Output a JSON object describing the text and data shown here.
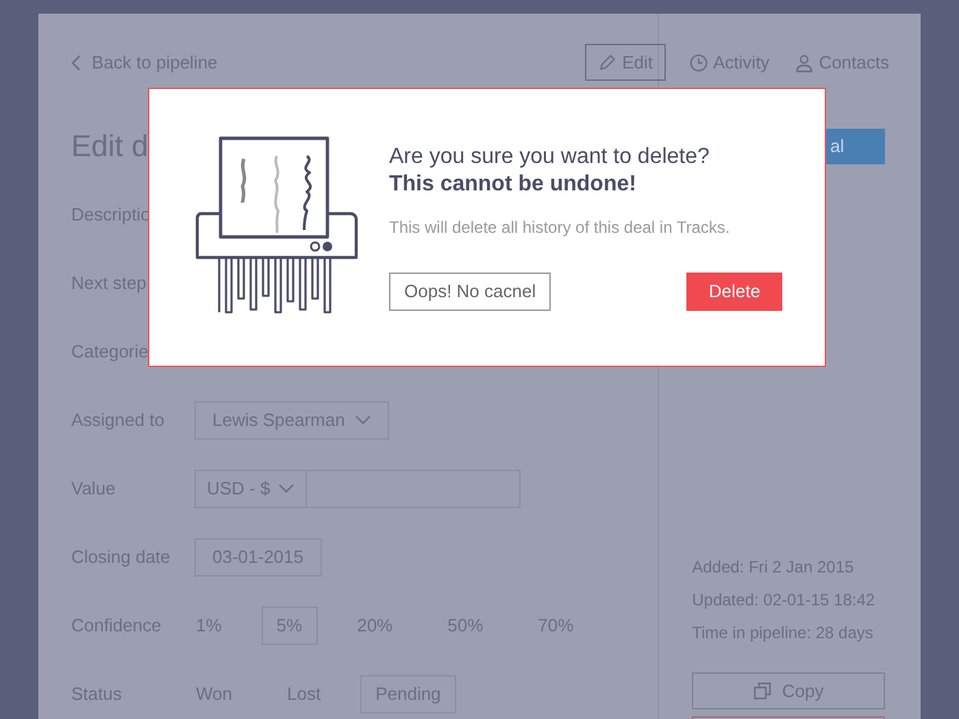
{
  "header": {
    "back_link": "Back to pipeline",
    "nav": [
      {
        "label": "Edit",
        "selected": true
      },
      {
        "label": "Activity",
        "selected": false
      },
      {
        "label": "Contacts",
        "selected": false
      }
    ]
  },
  "page_title": "Edit d",
  "sidebar_button": "al",
  "form": [
    {
      "label": "Descriptio",
      "kind": "hidden"
    },
    {
      "label": "Next step",
      "kind": "hidden"
    },
    {
      "label": "Categorie",
      "kind": "field"
    },
    {
      "label": "Assigned to",
      "kind": "select",
      "value": "Lewis Spearman"
    },
    {
      "label": "Value",
      "kind": "currency",
      "value": "USD - $"
    },
    {
      "label": "Closing date",
      "kind": "date",
      "value": "03-01-2015"
    },
    {
      "label": "Confidence",
      "kind": "options",
      "options": [
        {
          "label": "1%",
          "selected": false
        },
        {
          "label": "5%",
          "selected": true
        },
        {
          "label": "20%",
          "selected": false
        },
        {
          "label": "50%",
          "selected": false
        },
        {
          "label": "70%",
          "selected": false
        }
      ]
    },
    {
      "label": "Status",
      "kind": "options",
      "options": [
        {
          "label": "Won",
          "selected": false
        },
        {
          "label": "Lost",
          "selected": false
        },
        {
          "label": "Pending",
          "selected": true
        }
      ]
    }
  ],
  "meta": [
    "Added: Fri 2 Jan 2015",
    "Updated: 02-01-15 18:42",
    "Time in pipeline: 28 days"
  ],
  "copy_button": "Copy",
  "dialog": {
    "question": "Are you sure you want to delete?",
    "warning": "This cannot be undone!",
    "note": "This will delete all history of this deal in Tracks.",
    "cancel": "Oops! No cacnel",
    "confirm": "Delete"
  }
}
